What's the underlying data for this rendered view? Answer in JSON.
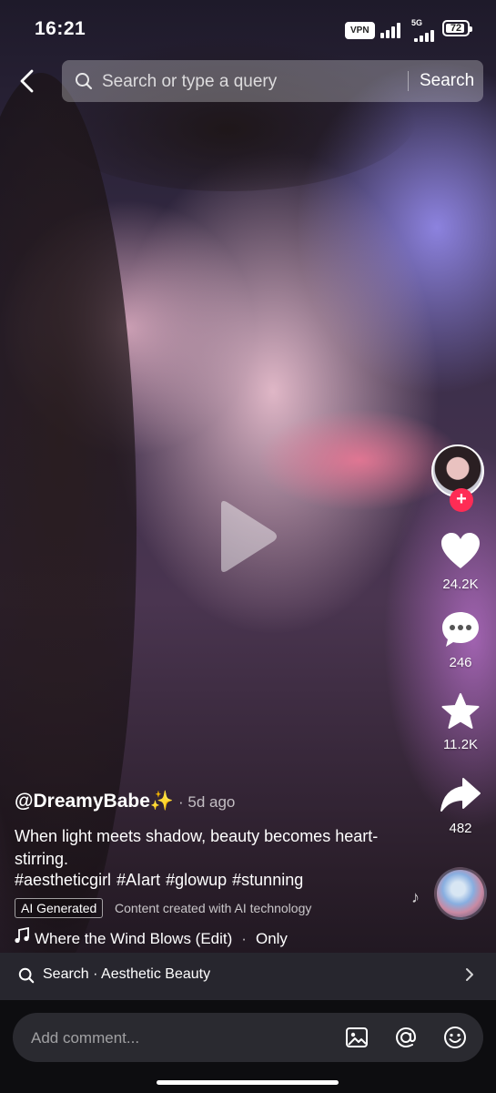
{
  "status_bar": {
    "time": "16:21",
    "vpn": "VPN",
    "network": "5G",
    "battery": "72"
  },
  "top_search": {
    "placeholder": "Search or type a query",
    "button_label": "Search"
  },
  "video": {
    "author": "@DreamyBabe✨",
    "age": "· 5d ago",
    "caption": "When light meets shadow, beauty becomes heart-stirring.",
    "hashtags": [
      "#aestheticgirl",
      "#AIart",
      "#glowup",
      "#stunning"
    ],
    "ai_badge": "AI Generated",
    "ai_note": "Content created with AI technology",
    "music_title": "Where the Wind Blows (Edit)",
    "music_separator": "·",
    "music_artist": "Only"
  },
  "actions": {
    "likes": "24.2K",
    "comments": "246",
    "favorites": "11.2K",
    "shares": "482"
  },
  "related_search": {
    "label": "Search",
    "separator": "·",
    "query": "Aesthetic Beauty"
  },
  "comment_bar": {
    "placeholder": "Add comment..."
  },
  "colors": {
    "follow_badge": "#fe2c55",
    "comment_bar_bg": "#2a2a30"
  },
  "icons": [
    "back-icon",
    "search-icon",
    "play-icon",
    "heart-icon",
    "comment-icon",
    "star-icon",
    "share-icon",
    "music-note-icon",
    "image-icon",
    "at-icon",
    "emoji-icon",
    "chevron-right-icon"
  ]
}
